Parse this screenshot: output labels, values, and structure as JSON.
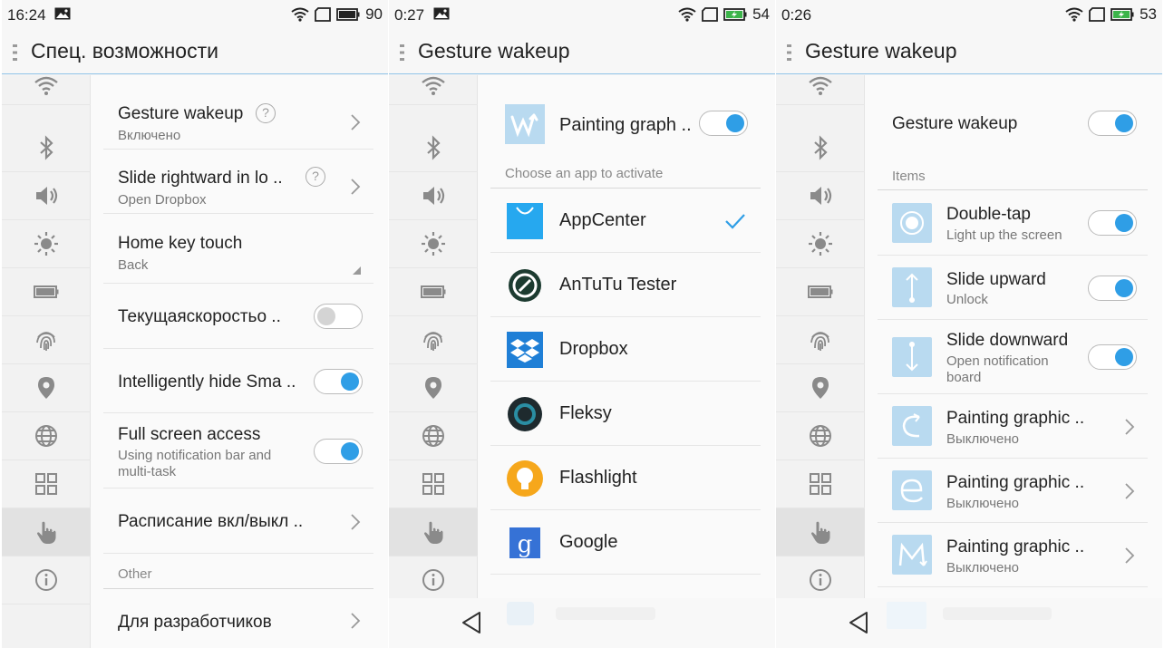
{
  "colors": {
    "accent": "#2f9ee6",
    "divider": "#8fc4e8",
    "gesture_icon_bg": "#b9daf0"
  },
  "sidebar_icons": [
    "wifi-icon",
    "bluetooth-icon",
    "volume-icon",
    "brightness-icon",
    "battery-icon",
    "fingerprint-icon",
    "location-icon",
    "globe-icon",
    "grid-icon",
    "hand-icon",
    "info-icon"
  ],
  "screen1": {
    "status": {
      "time": "16:24",
      "battery": "90"
    },
    "title": "Спец. возможности",
    "rows": [
      {
        "title": "Gesture wakeup",
        "sub": "Включено"
      },
      {
        "title": "Slide rightward in lo ..",
        "sub": "Open Dropbox"
      },
      {
        "title": "Home key touch",
        "sub": "Back"
      },
      {
        "title": "Текущаяскоростьо ..",
        "toggle": "off"
      },
      {
        "title": "Intelligently hide Sma ..",
        "toggle": "on"
      },
      {
        "title": "Full screen access",
        "sub_line1": "Using notification bar and",
        "sub_line2": "multi-task",
        "toggle": "on"
      },
      {
        "title": "Расписание вкл/выкл .."
      }
    ],
    "other_label": "Other",
    "dev_row": {
      "title": "Для разработчиков"
    }
  },
  "screen2": {
    "status": {
      "time": "0:27",
      "battery": "54"
    },
    "title": "Gesture wakeup",
    "header_item": {
      "title": "Painting graph ..",
      "toggle": "on"
    },
    "section_label": "Choose an app to activate",
    "apps": [
      {
        "name": "AppCenter",
        "icon": "appcenter-icon",
        "selected": true
      },
      {
        "name": "AnTuTu Tester",
        "icon": "antutu-icon"
      },
      {
        "name": "Dropbox",
        "icon": "dropbox-icon"
      },
      {
        "name": "Fleksy",
        "icon": "fleksy-icon"
      },
      {
        "name": "Flashlight",
        "icon": "flashlight-icon"
      },
      {
        "name": "Google",
        "icon": "google-icon"
      }
    ]
  },
  "screen3": {
    "status": {
      "time": "0:26",
      "battery": "53"
    },
    "title": "Gesture wakeup",
    "main_toggle": {
      "title": "Gesture wakeup",
      "toggle": "on"
    },
    "items_label": "Items",
    "items": [
      {
        "title": "Double-tap",
        "sub": "Light up the screen",
        "toggle": "on"
      },
      {
        "title": "Slide upward",
        "sub": "Unlock",
        "toggle": "on"
      },
      {
        "title": "Slide downward",
        "sub_line1": "Open notification",
        "sub_line2": "board",
        "toggle": "on"
      },
      {
        "title": "Painting graphic ..",
        "sub": "Выключено"
      },
      {
        "title": "Painting graphic ..",
        "sub": "Выключено"
      },
      {
        "title": "Painting graphic ..",
        "sub": "Выключено"
      }
    ]
  }
}
